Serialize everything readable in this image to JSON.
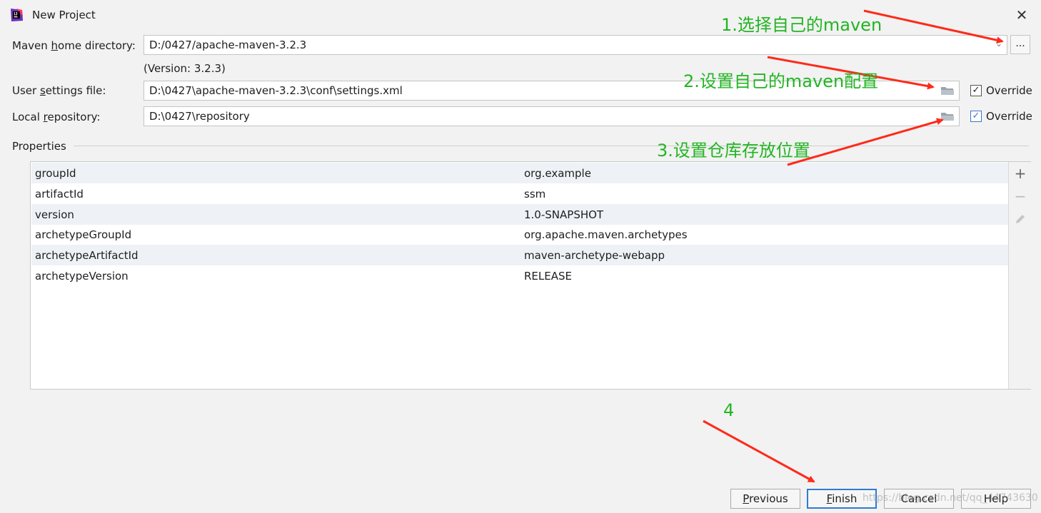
{
  "window": {
    "title": "New Project",
    "close_glyph": "✕"
  },
  "maven": {
    "home_label_pre": "Maven ",
    "home_label_u": "h",
    "home_label_post": "ome directory:",
    "home_value": "D:/0427/apache-maven-3.2.3",
    "version_text": "(Version: 3.2.3)",
    "browse_label": "...",
    "settings_label_pre": "User ",
    "settings_label_u": "s",
    "settings_label_post": "ettings file:",
    "settings_value": "D:\\0427\\apache-maven-3.2.3\\conf\\settings.xml",
    "repo_label_pre": "Local ",
    "repo_label_u": "r",
    "repo_label_post": "epository:",
    "repo_value": "D:\\0427\\repository",
    "override_label": "Override",
    "settings_override_checked": true,
    "repo_override_checked": true
  },
  "properties": {
    "title": "Properties",
    "rows": [
      {
        "key": "groupId",
        "value": "org.example"
      },
      {
        "key": "artifactId",
        "value": "ssm"
      },
      {
        "key": "version",
        "value": "1.0-SNAPSHOT"
      },
      {
        "key": "archetypeGroupId",
        "value": "org.apache.maven.archetypes"
      },
      {
        "key": "archetypeArtifactId",
        "value": "maven-archetype-webapp"
      },
      {
        "key": "archetypeVersion",
        "value": "RELEASE"
      }
    ]
  },
  "buttons": {
    "previous_u": "P",
    "previous_rest": "revious",
    "finish_u": "F",
    "finish_rest": "inish",
    "cancel": "Cancel",
    "help": "Help"
  },
  "annotations": {
    "step1": "1.选择自己的maven",
    "step2": "2.设置自己的maven配置",
    "step3": "3.设置仓库存放位置",
    "step4": "4",
    "color": "#22b522",
    "arrow_color": "#ff2a1a"
  },
  "watermark": "https://blog.csdn.net/qq_44743630"
}
